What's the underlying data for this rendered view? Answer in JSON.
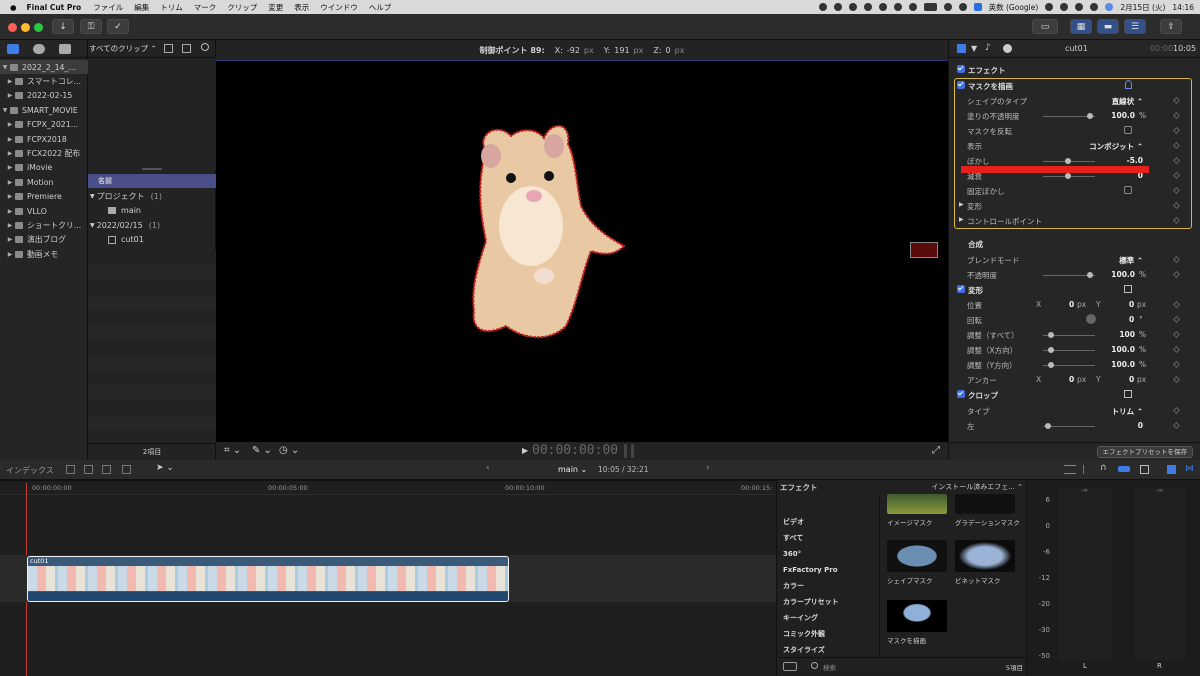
{
  "menubar": {
    "apple": "",
    "app_name": "Final Cut Pro",
    "items": [
      "ファイル",
      "編集",
      "トリム",
      "マーク",
      "クリップ",
      "変更",
      "表示",
      "ウインドウ",
      "ヘルプ"
    ],
    "input_source": "英数 (Google)",
    "date": "2月15日 (火)",
    "time": "14:16"
  },
  "toolbar": {
    "import_icon": "↓",
    "key_icon": "⚿",
    "check_icon": "✓"
  },
  "library": {
    "items": [
      {
        "label": "2022_2_14_...",
        "level": 0,
        "selected": true
      },
      {
        "label": "スマートコレ...",
        "level": 1
      },
      {
        "label": "2022-02-15",
        "level": 1
      },
      {
        "label": "SMART_MOVIE",
        "level": 0
      },
      {
        "label": "FCPX_2021...",
        "level": 1
      },
      {
        "label": "FCPX2018",
        "level": 1
      },
      {
        "label": "FCX2022 配布",
        "level": 1
      },
      {
        "label": "iMovie",
        "level": 1
      },
      {
        "label": "Motion",
        "level": 1
      },
      {
        "label": "Premiere",
        "level": 1
      },
      {
        "label": "VLLO",
        "level": 1
      },
      {
        "label": "ショートクリ...",
        "level": 1
      },
      {
        "label": "演出ブログ",
        "level": 1
      },
      {
        "label": "動画メモ",
        "level": 1
      }
    ]
  },
  "browser": {
    "filter": "すべてのクリップ ⌃",
    "column_name": "名前",
    "groups": [
      {
        "label": "プロジェクト",
        "count": "(1)",
        "items": [
          "main"
        ]
      },
      {
        "label": "2022/02/15",
        "count": "(1)",
        "items": [
          "cut01"
        ]
      }
    ],
    "footer": "2項目"
  },
  "viewer": {
    "control_point_label": "制御ポイント 89:",
    "x_label": "X:",
    "x_value": "-92",
    "y_label": "Y:",
    "y_value": "191",
    "z_label": "Z:",
    "z_value": "0",
    "unit": "px",
    "timecode": "00:00:00:00",
    "play_icon": "▶"
  },
  "inspector": {
    "clip_name": "cut01",
    "timecode_dim": "00:00",
    "timecode": "10:05",
    "effects_label": "エフェクト",
    "draw_mask_label": "マスクを描画",
    "shape_type_label": "シェイプのタイプ",
    "shape_type_value": "直線状 ⌃",
    "fill_opacity_label": "塗りの不透明度",
    "fill_opacity_value": "100.0",
    "percent": "%",
    "invert_label": "マスクを反転",
    "display_label": "表示",
    "display_value": "コンポジット ⌃",
    "blur_label": "ぼかし",
    "blur_value": "-5.0",
    "falloff_label": "減衰",
    "falloff_value": "0",
    "fixed_blur_label": "固定ぼかし",
    "transform_label": "変形",
    "control_points_label": "コントロールポイント",
    "composite_label": "合成",
    "blend_mode_label": "ブレンドモード",
    "blend_mode_value": "標準 ⌃",
    "opacity_label": "不透明度",
    "opacity_value": "100.0",
    "transform2_label": "変形",
    "position_label": "位置",
    "x": "X",
    "y": "Y",
    "pos_x": "0",
    "pos_y": "0",
    "px": "px",
    "rotation_label": "回転",
    "rotation_value": "0",
    "deg": "°",
    "scale_all_label": "調整（すべて）",
    "scale_all_value": "100",
    "scale_x_label": "調整（X方向）",
    "scale_x_value": "100.0",
    "scale_y_label": "調整（Y方向）",
    "scale_y_value": "100.0",
    "anchor_label": "アンカー",
    "anchor_x": "0",
    "anchor_y": "0",
    "crop_label": "クロップ",
    "type_label": "タイプ",
    "type_value": "トリム ⌃",
    "left_label": "左",
    "left_value": "0",
    "save_preset": "エフェクトプリセットを保存",
    "redline_color": "#e8201a"
  },
  "timeline": {
    "index_label": "インデックス",
    "project_name": "main ⌄",
    "duration": "10:05 / 32:21",
    "ruler": [
      "00:00:00:00",
      "00:00:05:00",
      "00:00:10:00",
      "00:00:15:"
    ],
    "clip_label": "cut01"
  },
  "effects": {
    "header": "エフェクト",
    "installed": "インストール済みエフェ... ⌃",
    "categories": [
      "ビデオ",
      "すべて",
      "360°",
      "FxFactory Pro",
      "カラー",
      "カラープリセット",
      "キーイング",
      "コミック外観",
      "スタイライズ"
    ],
    "thumbs": [
      "イメージマスク",
      "グラデーションマスク",
      "シェイプマスク",
      "ビネットマスク",
      "マスクを描画"
    ],
    "search_placeholder": "検索",
    "count": "5項目"
  },
  "meters": {
    "ticks": [
      "6",
      "0",
      "-6",
      "-12",
      "-20",
      "-30",
      "-50"
    ],
    "left_label": "L",
    "right_label": "R",
    "left_peak": "-∞",
    "right_peak": "-∞"
  }
}
